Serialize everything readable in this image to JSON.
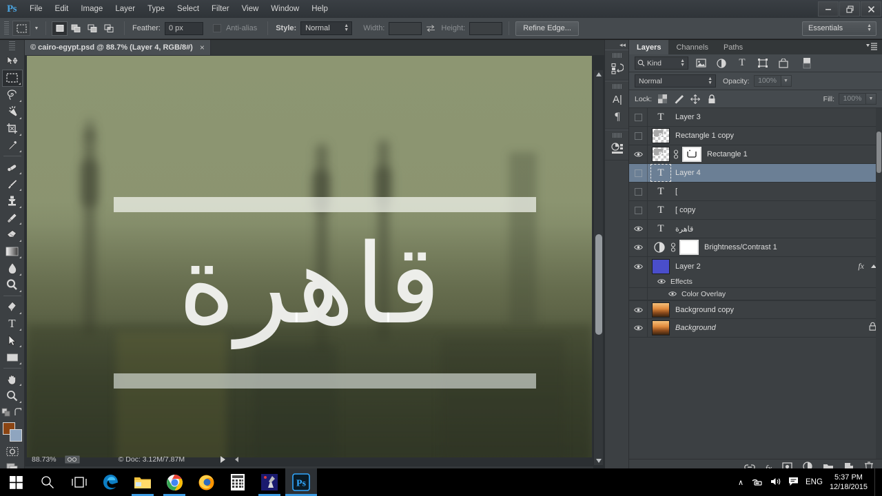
{
  "app": {
    "logo": "Ps",
    "menus": [
      "File",
      "Edit",
      "Image",
      "Layer",
      "Type",
      "Select",
      "Filter",
      "View",
      "Window",
      "Help"
    ],
    "window_controls": {
      "minimize": "–",
      "restore": "❐",
      "close": "✕"
    }
  },
  "options_bar": {
    "tool_icon": "rectangular-marquee",
    "selection_modes": [
      "new-selection",
      "add-to-selection",
      "subtract-from-selection",
      "intersect-selection"
    ],
    "feather_label": "Feather:",
    "feather_value": "0 px",
    "antialias_label": "Anti-alias",
    "antialias_checked": false,
    "style_label": "Style:",
    "style_value": "Normal",
    "width_label": "Width:",
    "width_value": "",
    "swap_icon": "swap-arrows",
    "height_label": "Height:",
    "height_value": "",
    "refine_edge_label": "Refine Edge...",
    "workspace_value": "Essentials"
  },
  "toolbar": {
    "tools_top": [
      "move-tool",
      "rectangular-marquee-tool",
      "lasso-tool",
      "magic-wand-tool",
      "crop-tool",
      "eyedropper-tool"
    ],
    "tools_mid": [
      "spot-healing-brush-tool",
      "brush-tool",
      "clone-stamp-tool",
      "history-brush-tool",
      "eraser-tool",
      "gradient-tool",
      "blur-tool",
      "dodge-tool"
    ],
    "tools_bot": [
      "pen-tool",
      "horizontal-type-tool",
      "path-selection-tool",
      "rectangle-tool"
    ],
    "tools_nav": [
      "hand-tool",
      "zoom-tool"
    ],
    "extras": [
      "edit-in-quick-mask-mode",
      "change-screen-mode"
    ],
    "foreground_color": "#8b4513",
    "background_color": "#8fa5bf",
    "selected_tool": "rectangular-marquee-tool"
  },
  "document": {
    "tab_title": "© cairo-egypt.psd @ 88.7% (Layer 4, RGB/8#)",
    "tab_close": "×",
    "canvas_text": "قاهرة",
    "status_zoom": "88.73%",
    "status_doc": "© Doc: 3.12M/7.87M"
  },
  "icon_rail": {
    "groups": [
      [
        "history-panel-icon"
      ],
      [
        "character-panel-icon",
        "paragraph-panel-icon"
      ],
      [
        "properties-panel-icon"
      ]
    ],
    "collapse_label": "◂◂"
  },
  "layers_panel": {
    "tabs": [
      {
        "label": "Layers",
        "active": true
      },
      {
        "label": "Channels",
        "active": false
      },
      {
        "label": "Paths",
        "active": false
      }
    ],
    "menu_icon": "panel-menu-icon",
    "filter": {
      "search_icon": "search-icon",
      "kind_label": "Kind",
      "filter_icons": [
        "filter-pixel-layers-icon",
        "filter-adjustment-layers-icon",
        "filter-type-layers-icon",
        "filter-shape-layers-icon",
        "filter-smart-objects-icon"
      ],
      "toggle_icon": "filter-toggle-icon"
    },
    "blend_mode": "Normal",
    "opacity_label": "Opacity:",
    "opacity_value": "100%",
    "lock_label": "Lock:",
    "lock_icons": [
      "lock-transparent-pixels",
      "lock-image-pixels",
      "lock-position",
      "lock-all"
    ],
    "fill_label": "Fill:",
    "fill_value": "100%",
    "layers": [
      {
        "name": "Layer 3",
        "visible": false,
        "type": "text",
        "selected": false
      },
      {
        "name": "Rectangle 1 copy",
        "visible": false,
        "type": "shape",
        "selected": false
      },
      {
        "name": "Rectangle 1",
        "visible": true,
        "type": "shape-masked",
        "selected": false
      },
      {
        "name": "Layer 4",
        "visible": false,
        "type": "text-framed",
        "selected": true
      },
      {
        "name": "[",
        "visible": false,
        "type": "text",
        "selected": false
      },
      {
        "name": "[ copy",
        "visible": false,
        "type": "text",
        "selected": false
      },
      {
        "name": "قاهرة",
        "visible": true,
        "type": "text",
        "selected": false
      },
      {
        "name": "Brightness/Contrast 1",
        "visible": true,
        "type": "adjustment",
        "selected": false
      },
      {
        "name": "Layer 2",
        "visible": true,
        "type": "solid-color",
        "selected": false,
        "fx": "fx",
        "effects_label": "Effects",
        "effect_items": [
          "Color Overlay"
        ]
      },
      {
        "name": "Background copy",
        "visible": true,
        "type": "photo",
        "selected": false
      },
      {
        "name": "Background",
        "visible": true,
        "type": "photo",
        "selected": false,
        "italic": true,
        "locked": true
      }
    ],
    "footer_icons": [
      "link-layers-icon",
      "add-layer-style-icon",
      "add-layer-mask-icon",
      "new-fill-adjustment-layer-icon",
      "new-group-icon",
      "new-layer-icon",
      "delete-layer-icon"
    ]
  },
  "taskbar": {
    "start_label": "start-button",
    "items": [
      "start-icon",
      "search-icon",
      "task-view-icon",
      "edge-icon",
      "file-explorer-icon",
      "chrome-icon",
      "firefox-icon",
      "calculator-icon",
      "paint-icon",
      "photoshop-icon"
    ],
    "tray": {
      "expand_icon": "∧",
      "network_icon": "network-icon",
      "volume_icon": "volume-icon",
      "action_center_icon": "action-center-icon",
      "language": "ENG",
      "time": "5:37 PM",
      "date": "12/18/2015"
    }
  }
}
